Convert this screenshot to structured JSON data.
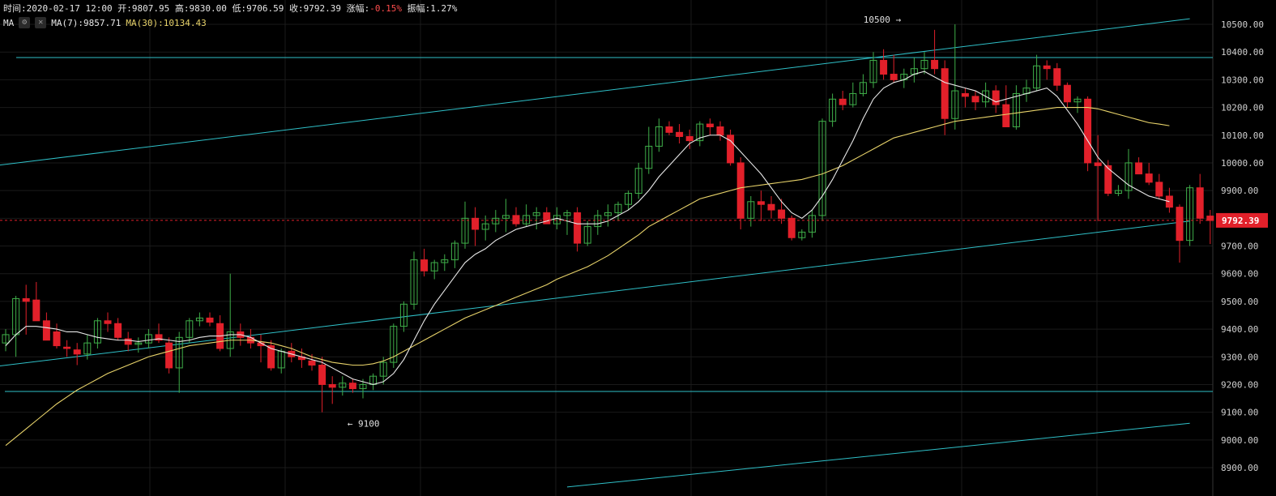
{
  "header": {
    "time_label": "时间:",
    "time_value": "2020-02-17 12:00",
    "open_label": "开:",
    "open_value": "9807.95",
    "high_label": "高:",
    "high_value": "9830.00",
    "low_label": "低:",
    "low_value": "9706.59",
    "close_label": "收:",
    "close_value": "9792.39",
    "change_label": "涨幅:",
    "change_value": "-0.15%",
    "amplitude_label": "振幅:",
    "amplitude_value": "1.27%"
  },
  "indicator": {
    "name": "MA",
    "settings_icon": "gear-icon",
    "close_icon": "close-icon",
    "ma7_label": "MA(7):",
    "ma7_value": "9857.71",
    "ma30_label": "MA(30):",
    "ma30_value": "10134.43"
  },
  "colors": {
    "background": "#000000",
    "grid": "#1a1a1a",
    "up": "#3fae49",
    "down": "#e2202a",
    "ma7": "#e8e8e8",
    "ma30": "#e8d36a",
    "trendline": "#2fc0c8",
    "price_tag": "#e2202a"
  },
  "chart_data": {
    "type": "candlestick",
    "y_ticks": [
      "10500.00",
      "10400.00",
      "10300.00",
      "10200.00",
      "10100.00",
      "10000.00",
      "9900.00",
      "9800.00",
      "9700.00",
      "9600.00",
      "9500.00",
      "9400.00",
      "9300.00",
      "9200.00",
      "9100.00",
      "9000.00",
      "8900.00"
    ],
    "ylim": [
      8850,
      10560
    ],
    "current_price": "9792.39",
    "annotations": [
      {
        "text": "10500 →",
        "price": 10500,
        "candle_index": 88
      },
      {
        "text": "← 9100",
        "price": 9100,
        "candle_index": 33
      }
    ],
    "horizontal_lines": [
      10380,
      9175
    ],
    "ohlc": [
      [
        9350,
        9400,
        9320,
        9380
      ],
      [
        9380,
        9520,
        9300,
        9510
      ],
      [
        9510,
        9560,
        9380,
        9500
      ],
      [
        9505,
        9570,
        9430,
        9430
      ],
      [
        9430,
        9460,
        9380,
        9360
      ],
      [
        9390,
        9420,
        9330,
        9340
      ],
      [
        9335,
        9360,
        9300,
        9330
      ],
      [
        9325,
        9350,
        9270,
        9310
      ],
      [
        9310,
        9380,
        9290,
        9350
      ],
      [
        9350,
        9440,
        9330,
        9430
      ],
      [
        9430,
        9460,
        9390,
        9420
      ],
      [
        9420,
        9440,
        9360,
        9370
      ],
      [
        9365,
        9390,
        9320,
        9345
      ],
      [
        9345,
        9370,
        9315,
        9350
      ],
      [
        9350,
        9400,
        9330,
        9380
      ],
      [
        9380,
        9420,
        9350,
        9360
      ],
      [
        9350,
        9370,
        9240,
        9260
      ],
      [
        9260,
        9390,
        9170,
        9370
      ],
      [
        9370,
        9440,
        9350,
        9430
      ],
      [
        9430,
        9460,
        9410,
        9440
      ],
      [
        9440,
        9460,
        9410,
        9425
      ],
      [
        9420,
        9450,
        9320,
        9330
      ],
      [
        9330,
        9600,
        9300,
        9390
      ],
      [
        9390,
        9420,
        9340,
        9370
      ],
      [
        9370,
        9400,
        9330,
        9350
      ],
      [
        9350,
        9380,
        9280,
        9340
      ],
      [
        9340,
        9360,
        9250,
        9260
      ],
      [
        9260,
        9330,
        9240,
        9320
      ],
      [
        9320,
        9350,
        9280,
        9300
      ],
      [
        9300,
        9330,
        9260,
        9290
      ],
      [
        9285,
        9310,
        9250,
        9270
      ],
      [
        9270,
        9300,
        9100,
        9200
      ],
      [
        9200,
        9230,
        9130,
        9190
      ],
      [
        9190,
        9230,
        9160,
        9205
      ],
      [
        9205,
        9220,
        9170,
        9185
      ],
      [
        9185,
        9220,
        9150,
        9200
      ],
      [
        9200,
        9240,
        9180,
        9230
      ],
      [
        9230,
        9300,
        9200,
        9280
      ],
      [
        9280,
        9420,
        9260,
        9410
      ],
      [
        9410,
        9500,
        9390,
        9490
      ],
      [
        9490,
        9680,
        9470,
        9650
      ],
      [
        9650,
        9690,
        9590,
        9610
      ],
      [
        9610,
        9650,
        9580,
        9640
      ],
      [
        9640,
        9670,
        9610,
        9650
      ],
      [
        9650,
        9720,
        9620,
        9710
      ],
      [
        9710,
        9860,
        9690,
        9800
      ],
      [
        9800,
        9840,
        9700,
        9760
      ],
      [
        9760,
        9810,
        9720,
        9780
      ],
      [
        9780,
        9830,
        9750,
        9800
      ],
      [
        9800,
        9870,
        9750,
        9810
      ],
      [
        9810,
        9840,
        9770,
        9780
      ],
      [
        9780,
        9850,
        9770,
        9810
      ],
      [
        9810,
        9840,
        9760,
        9820
      ],
      [
        9820,
        9840,
        9780,
        9780
      ],
      [
        9780,
        9840,
        9760,
        9810
      ],
      [
        9810,
        9830,
        9740,
        9820
      ],
      [
        9820,
        9840,
        9680,
        9710
      ],
      [
        9710,
        9790,
        9700,
        9770
      ],
      [
        9770,
        9830,
        9740,
        9810
      ],
      [
        9810,
        9850,
        9770,
        9820
      ],
      [
        9820,
        9860,
        9790,
        9850
      ],
      [
        9850,
        9900,
        9830,
        9890
      ],
      [
        9890,
        10000,
        9870,
        9980
      ],
      [
        9980,
        10130,
        9960,
        10060
      ],
      [
        10060,
        10160,
        10040,
        10130
      ],
      [
        10130,
        10150,
        10100,
        10110
      ],
      [
        10110,
        10140,
        10070,
        10095
      ],
      [
        10095,
        10120,
        10050,
        10080
      ],
      [
        10080,
        10150,
        10060,
        10140
      ],
      [
        10140,
        10160,
        10100,
        10130
      ],
      [
        10130,
        10150,
        10080,
        10100
      ],
      [
        10100,
        10120,
        9990,
        10000
      ],
      [
        10000,
        10020,
        9760,
        9800
      ],
      [
        9800,
        9880,
        9770,
        9860
      ],
      [
        9860,
        9900,
        9790,
        9850
      ],
      [
        9850,
        9880,
        9800,
        9830
      ],
      [
        9830,
        9870,
        9780,
        9800
      ],
      [
        9800,
        9810,
        9720,
        9730
      ],
      [
        9730,
        9760,
        9720,
        9750
      ],
      [
        9750,
        9830,
        9730,
        9810
      ],
      [
        9810,
        10160,
        9790,
        10150
      ],
      [
        10150,
        10250,
        10130,
        10230
      ],
      [
        10230,
        10260,
        10190,
        10210
      ],
      [
        10210,
        10290,
        10200,
        10250
      ],
      [
        10250,
        10320,
        10240,
        10290
      ],
      [
        10290,
        10400,
        10270,
        10370
      ],
      [
        10370,
        10410,
        10300,
        10320
      ],
      [
        10320,
        10390,
        10290,
        10300
      ],
      [
        10300,
        10340,
        10270,
        10320
      ],
      [
        10320,
        10380,
        10290,
        10340
      ],
      [
        10340,
        10400,
        10320,
        10370
      ],
      [
        10370,
        10480,
        10320,
        10340
      ],
      [
        10340,
        10370,
        10100,
        10160
      ],
      [
        10160,
        10500,
        10120,
        10260
      ],
      [
        10250,
        10270,
        10200,
        10240
      ],
      [
        10240,
        10260,
        10190,
        10220
      ],
      [
        10220,
        10290,
        10200,
        10260
      ],
      [
        10260,
        10280,
        10180,
        10210
      ],
      [
        10210,
        10280,
        10130,
        10130
      ],
      [
        10130,
        10280,
        10120,
        10250
      ],
      [
        10250,
        10300,
        10220,
        10270
      ],
      [
        10270,
        10390,
        10260,
        10350
      ],
      [
        10350,
        10370,
        10300,
        10340
      ],
      [
        10340,
        10360,
        10260,
        10280
      ],
      [
        10280,
        10290,
        10200,
        10220
      ],
      [
        10220,
        10240,
        10180,
        10230
      ],
      [
        10230,
        10240,
        9970,
        10000
      ],
      [
        10000,
        10100,
        9790,
        9990
      ],
      [
        9990,
        10010,
        9880,
        9890
      ],
      [
        9890,
        9920,
        9880,
        9900
      ],
      [
        9900,
        10050,
        9870,
        10000
      ],
      [
        10000,
        10020,
        9960,
        9960
      ],
      [
        9960,
        10000,
        9920,
        9930
      ],
      [
        9930,
        9960,
        9870,
        9880
      ],
      [
        9880,
        9910,
        9820,
        9840
      ],
      [
        9840,
        9850,
        9640,
        9720
      ],
      [
        9720,
        9920,
        9700,
        9910
      ],
      [
        9910,
        9960,
        9780,
        9800
      ],
      [
        9808,
        9830,
        9707,
        9792
      ]
    ],
    "ma7": [
      9340,
      9380,
      9410,
      9410,
      9405,
      9400,
      9390,
      9390,
      9380,
      9370,
      9365,
      9360,
      9360,
      9355,
      9360,
      9365,
      9360,
      9355,
      9360,
      9370,
      9375,
      9375,
      9380,
      9380,
      9370,
      9350,
      9330,
      9320,
      9310,
      9300,
      9290,
      9280,
      9260,
      9240,
      9220,
      9210,
      9200,
      9210,
      9240,
      9290,
      9360,
      9430,
      9490,
      9540,
      9590,
      9640,
      9670,
      9690,
      9720,
      9740,
      9760,
      9770,
      9780,
      9790,
      9800,
      9790,
      9780,
      9780,
      9780,
      9790,
      9810,
      9830,
      9860,
      9900,
      9950,
      9990,
      10030,
      10070,
      10090,
      10100,
      10100,
      10080,
      10040,
      10000,
      9960,
      9910,
      9860,
      9820,
      9800,
      9830,
      9880,
      9940,
      10010,
      10080,
      10160,
      10230,
      10270,
      10290,
      10300,
      10320,
      10330,
      10310,
      10290,
      10280,
      10270,
      10260,
      10240,
      10220,
      10230,
      10240,
      10250,
      10260,
      10270,
      10240,
      10190,
      10140,
      10080,
      10020,
      9980,
      9950,
      9920,
      9900,
      9880,
      9870,
      9860
    ],
    "ma30": [
      8980,
      9010,
      9040,
      9070,
      9100,
      9130,
      9155,
      9180,
      9200,
      9220,
      9240,
      9255,
      9270,
      9285,
      9300,
      9310,
      9320,
      9330,
      9340,
      9345,
      9350,
      9355,
      9360,
      9360,
      9360,
      9355,
      9350,
      9340,
      9330,
      9315,
      9300,
      9290,
      9280,
      9275,
      9270,
      9270,
      9275,
      9285,
      9300,
      9320,
      9340,
      9360,
      9380,
      9400,
      9420,
      9440,
      9455,
      9470,
      9485,
      9500,
      9515,
      9530,
      9545,
      9560,
      9580,
      9595,
      9610,
      9625,
      9645,
      9665,
      9690,
      9715,
      9740,
      9770,
      9790,
      9810,
      9830,
      9850,
      9870,
      9880,
      9890,
      9900,
      9910,
      9915,
      9920,
      9925,
      9930,
      9935,
      9940,
      9950,
      9960,
      9975,
      9990,
      10010,
      10030,
      10050,
      10070,
      10090,
      10100,
      10110,
      10120,
      10130,
      10140,
      10150,
      10155,
      10160,
      10165,
      10170,
      10175,
      10180,
      10185,
      10190,
      10195,
      10200,
      10200,
      10200,
      10200,
      10195,
      10185,
      10175,
      10165,
      10155,
      10145,
      10140,
      10134
    ],
    "trendlines": [
      {
        "from": [
          -1,
          9990
        ],
        "to": [
          116,
          10520
        ]
      },
      {
        "from": [
          -1,
          9265
        ],
        "to": [
          116,
          9790
        ]
      },
      {
        "from": [
          55,
          8830
        ],
        "to": [
          116,
          9060
        ]
      }
    ]
  }
}
